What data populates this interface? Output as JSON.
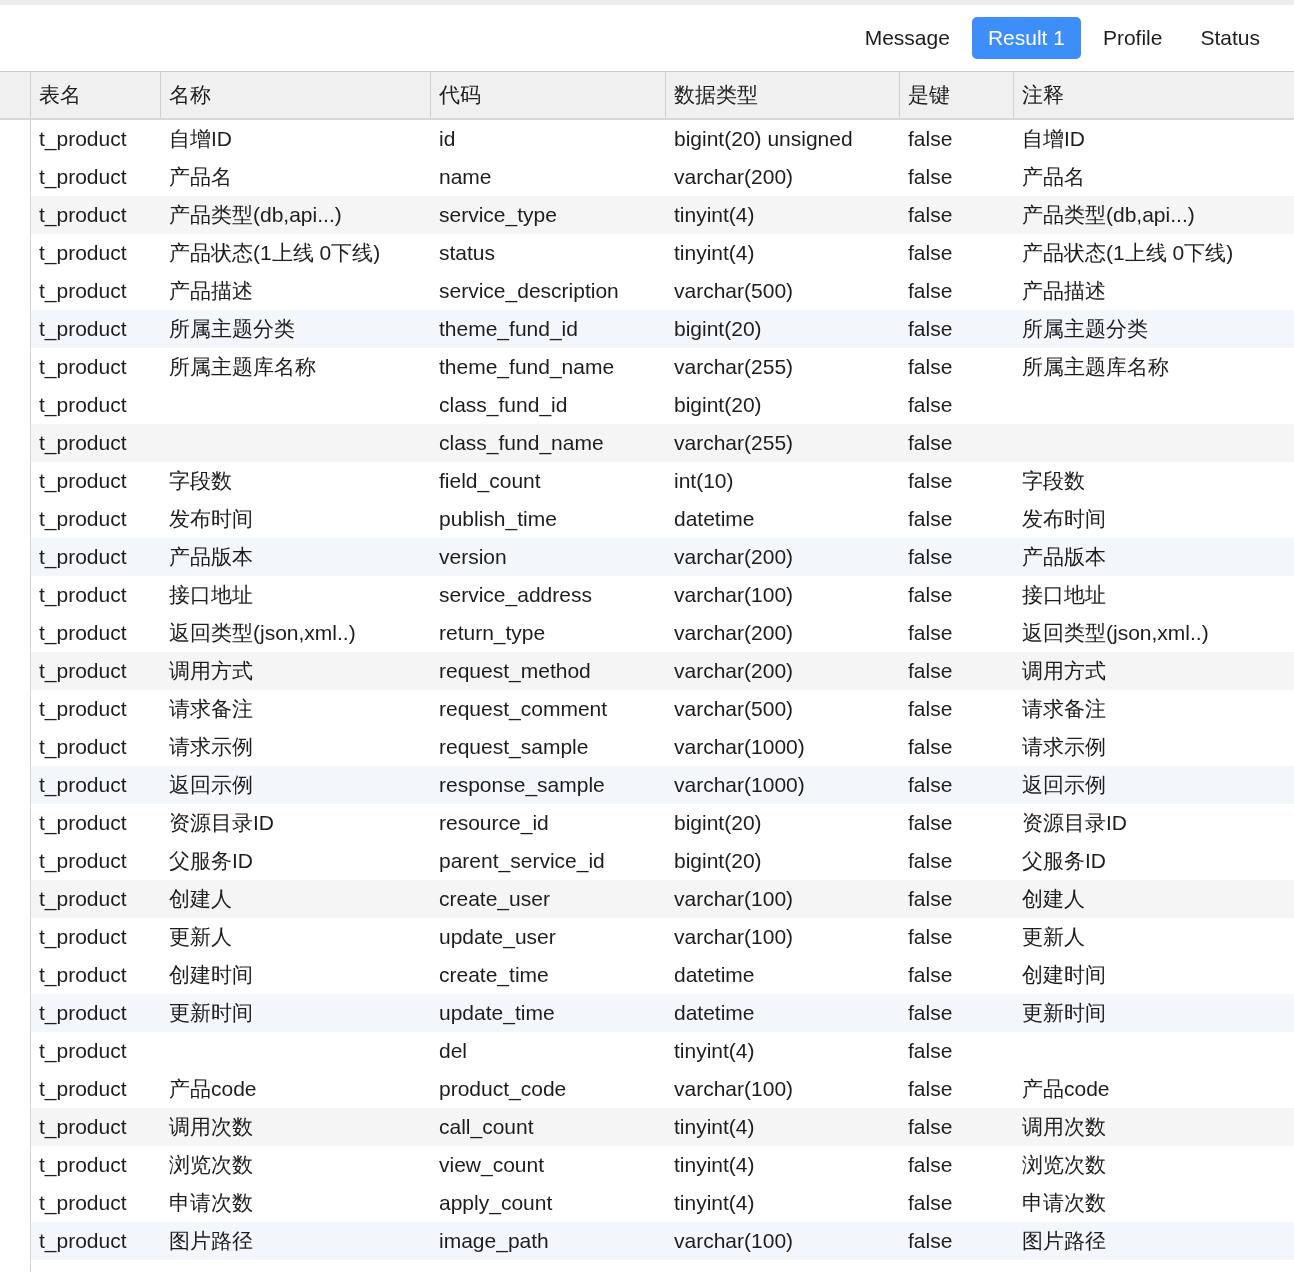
{
  "tabs": [
    {
      "label": "Message",
      "selected": false
    },
    {
      "label": "Result 1",
      "selected": true
    },
    {
      "label": "Profile",
      "selected": false
    },
    {
      "label": "Status",
      "selected": false
    }
  ],
  "table": {
    "columns": [
      "表名",
      "名称",
      "代码",
      "数据类型",
      "是键",
      "注释"
    ],
    "rows": [
      {
        "table": "t_product",
        "name": "自增ID",
        "code": "id",
        "type": "bigint(20) unsigned",
        "key": "false",
        "comment": "自增ID"
      },
      {
        "table": "t_product",
        "name": "产品名",
        "code": "name",
        "type": "varchar(200)",
        "key": "false",
        "comment": "产品名"
      },
      {
        "table": "t_product",
        "name": "产品类型(db,api...)",
        "code": "service_type",
        "type": "tinyint(4)",
        "key": "false",
        "comment": "产品类型(db,api...)"
      },
      {
        "table": "t_product",
        "name": "产品状态(1上线 0下线)",
        "code": "status",
        "type": "tinyint(4)",
        "key": "false",
        "comment": "产品状态(1上线 0下线)"
      },
      {
        "table": "t_product",
        "name": "产品描述",
        "code": "service_description",
        "type": "varchar(500)",
        "key": "false",
        "comment": "产品描述"
      },
      {
        "table": "t_product",
        "name": "所属主题分类",
        "code": "theme_fund_id",
        "type": "bigint(20)",
        "key": "false",
        "comment": "所属主题分类"
      },
      {
        "table": "t_product",
        "name": "所属主题库名称",
        "code": "theme_fund_name",
        "type": "varchar(255)",
        "key": "false",
        "comment": "所属主题库名称"
      },
      {
        "table": "t_product",
        "code": "class_fund_id",
        "type": "bigint(20)",
        "key": "false"
      },
      {
        "table": "t_product",
        "code": "class_fund_name",
        "type": "varchar(255)",
        "key": "false"
      },
      {
        "table": "t_product",
        "name": "字段数",
        "code": "field_count",
        "type": "int(10)",
        "key": "false",
        "comment": "字段数"
      },
      {
        "table": "t_product",
        "name": "发布时间",
        "code": "publish_time",
        "type": "datetime",
        "key": "false",
        "comment": "发布时间"
      },
      {
        "table": "t_product",
        "name": "产品版本",
        "code": "version",
        "type": "varchar(200)",
        "key": "false",
        "comment": "产品版本"
      },
      {
        "table": "t_product",
        "name": "接口地址",
        "code": "service_address",
        "type": "varchar(100)",
        "key": "false",
        "comment": "接口地址"
      },
      {
        "table": "t_product",
        "name": "返回类型(json,xml..)",
        "code": "return_type",
        "type": "varchar(200)",
        "key": "false",
        "comment": "返回类型(json,xml..)"
      },
      {
        "table": "t_product",
        "name": "调用方式",
        "code": "request_method",
        "type": "varchar(200)",
        "key": "false",
        "comment": "调用方式"
      },
      {
        "table": "t_product",
        "name": "请求备注",
        "code": "request_comment",
        "type": "varchar(500)",
        "key": "false",
        "comment": "请求备注"
      },
      {
        "table": "t_product",
        "name": "请求示例",
        "code": "request_sample",
        "type": "varchar(1000)",
        "key": "false",
        "comment": "请求示例"
      },
      {
        "table": "t_product",
        "name": "返回示例",
        "code": "response_sample",
        "type": "varchar(1000)",
        "key": "false",
        "comment": "返回示例"
      },
      {
        "table": "t_product",
        "name": "资源目录ID",
        "code": "resource_id",
        "type": "bigint(20)",
        "key": "false",
        "comment": "资源目录ID"
      },
      {
        "table": "t_product",
        "name": "父服务ID",
        "code": "parent_service_id",
        "type": "bigint(20)",
        "key": "false",
        "comment": "父服务ID"
      },
      {
        "table": "t_product",
        "name": "创建人",
        "code": "create_user",
        "type": "varchar(100)",
        "key": "false",
        "comment": "创建人"
      },
      {
        "table": "t_product",
        "name": "更新人",
        "code": "update_user",
        "type": "varchar(100)",
        "key": "false",
        "comment": "更新人"
      },
      {
        "table": "t_product",
        "name": "创建时间",
        "code": "create_time",
        "type": "datetime",
        "key": "false",
        "comment": "创建时间"
      },
      {
        "table": "t_product",
        "name": "更新时间",
        "code": "update_time",
        "type": "datetime",
        "key": "false",
        "comment": "更新时间"
      },
      {
        "table": "t_product",
        "code": "del",
        "type": "tinyint(4)",
        "key": "false"
      },
      {
        "table": "t_product",
        "name": "产品code",
        "code": "product_code",
        "type": "varchar(100)",
        "key": "false",
        "comment": "产品code"
      },
      {
        "table": "t_product",
        "name": "调用次数",
        "code": "call_count",
        "type": "tinyint(4)",
        "key": "false",
        "comment": "调用次数"
      },
      {
        "table": "t_product",
        "name": "浏览次数",
        "code": "view_count",
        "type": "tinyint(4)",
        "key": "false",
        "comment": "浏览次数"
      },
      {
        "table": "t_product",
        "name": "申请次数",
        "code": "apply_count",
        "type": "tinyint(4)",
        "key": "false",
        "comment": "申请次数"
      },
      {
        "table": "t_product",
        "name": "图片路径",
        "code": "image_path",
        "type": "varchar(100)",
        "key": "false",
        "comment": "图片路径"
      }
    ]
  }
}
